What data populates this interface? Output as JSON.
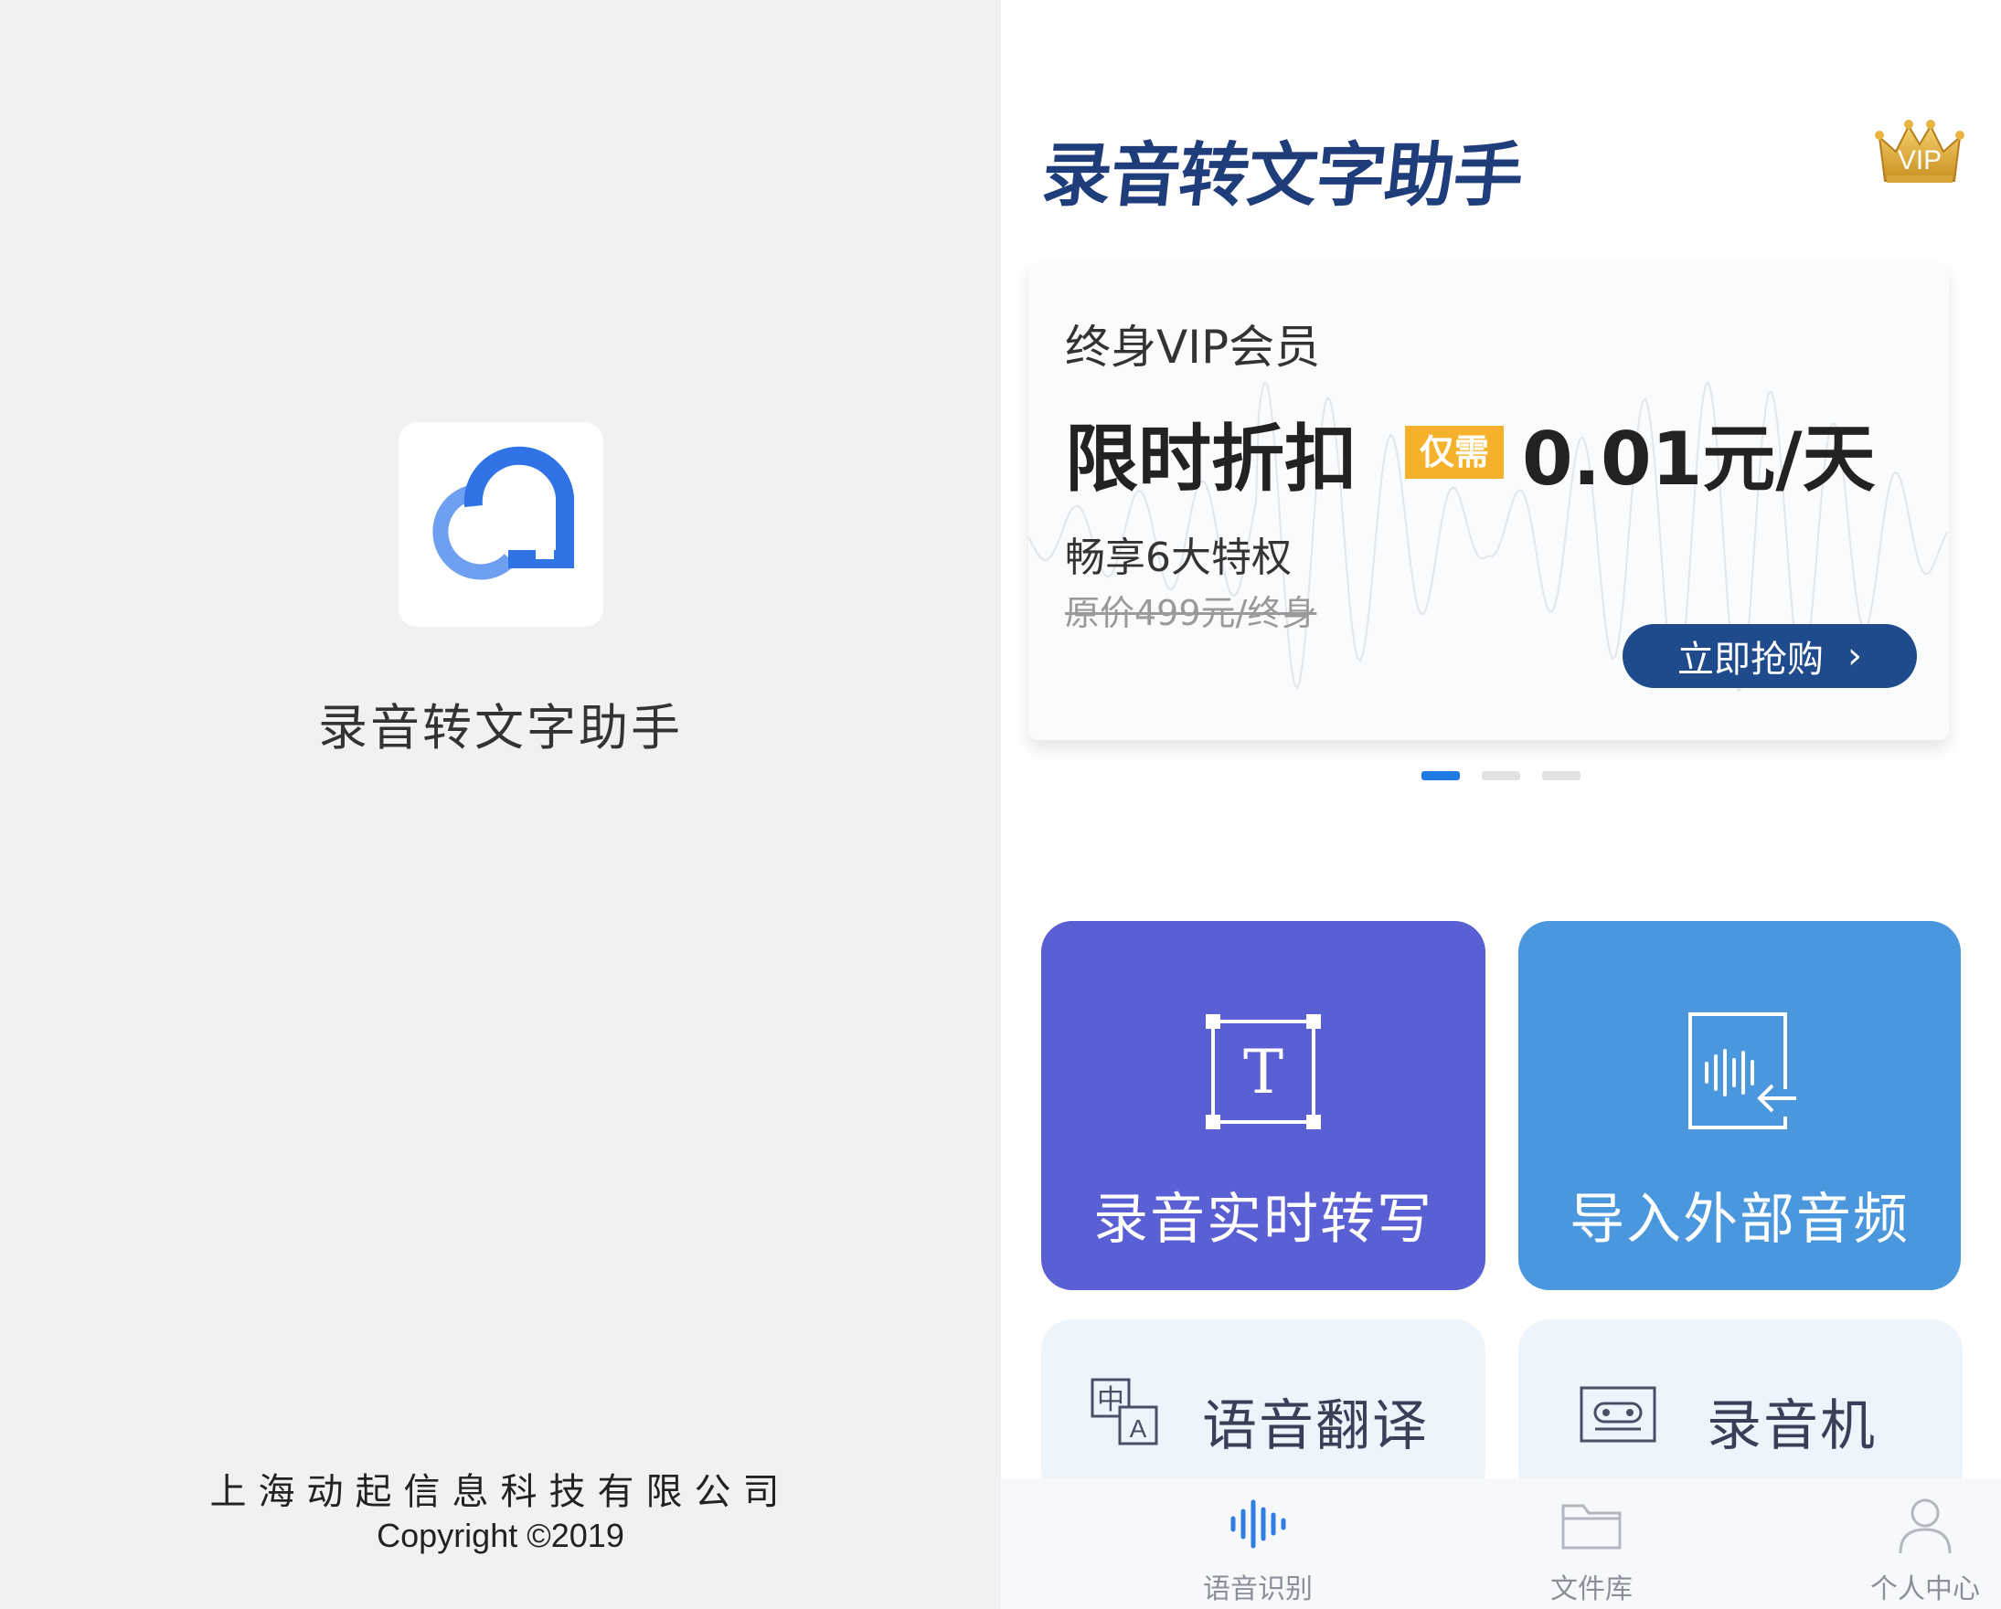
{
  "splash": {
    "app_name": "录音转文字助手",
    "company": "上海动起信息科技有限公司",
    "copyright": "Copyright ©2019"
  },
  "header": {
    "title": "录音转文字助手",
    "vip_badge": "VIP"
  },
  "banner": {
    "subtitle": "终身VIP会员",
    "headline": "限时折扣",
    "tag": "仅需",
    "price": "0.01元/天",
    "privileges": "畅享6大特权",
    "original_price": "原价499元/终身",
    "button_label": "立即抢购",
    "page_count": 3,
    "active_page": 1
  },
  "features": {
    "live": "录音实时转写",
    "import": "导入外部音频",
    "translate": "语音翻译",
    "recorder": "录音机"
  },
  "tabs": [
    {
      "label": "语音识别",
      "icon": "waveform-icon",
      "active": true
    },
    {
      "label": "文件库",
      "icon": "folder-icon",
      "active": false
    },
    {
      "label": "个人中心",
      "icon": "person-icon",
      "active": false
    }
  ],
  "colors": {
    "accent": "#1e7be6",
    "title": "#1f3d7a",
    "live_tile": "#5a5fd3",
    "import_tile": "#4a97de",
    "tag": "#f6b12c",
    "button": "#1f4a8c"
  }
}
